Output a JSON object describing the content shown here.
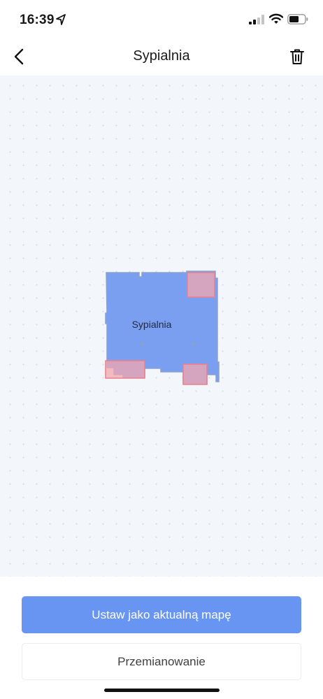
{
  "status_bar": {
    "time": "16:39",
    "icons": [
      "location-arrow-icon",
      "cellular-signal-icon",
      "wifi-icon",
      "battery-icon"
    ]
  },
  "nav": {
    "title": "Sypialnia",
    "back_icon": "chevron-left-icon",
    "delete_icon": "trash-icon"
  },
  "map": {
    "room_label": "Sypialnia",
    "room_color": "#7a9ff0",
    "no_go_zone_color": "#f4a6ae"
  },
  "actions": {
    "primary_label": "Ustaw jako aktualną mapę",
    "secondary_label": "Przemianowanie",
    "accent_color": "#6895f1"
  }
}
